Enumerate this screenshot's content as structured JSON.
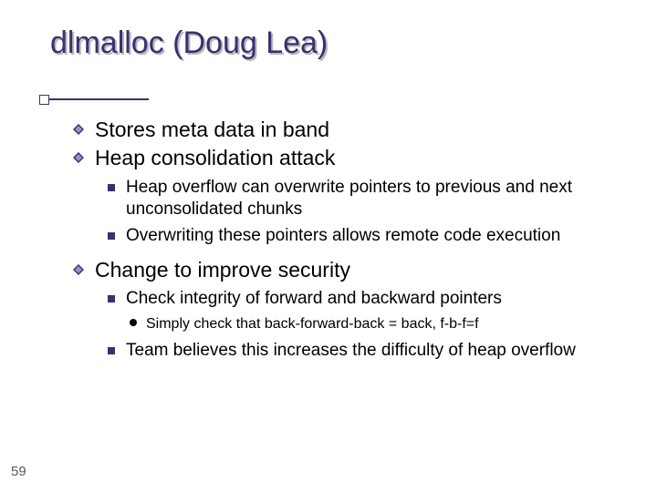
{
  "title": "dlmalloc (Doug Lea)",
  "points": {
    "p1": "Stores meta data in band",
    "p2": "Heap consolidation attack",
    "p2a": "Heap overflow can overwrite pointers to previous and next unconsolidated chunks",
    "p2b": "Overwriting these pointers allows remote code execution",
    "p3": "Change to improve security",
    "p3a": "Check integrity of forward and backward pointers",
    "p3a1": "Simply check that back-forward-back = back,  f-b-f=f",
    "p3b": "Team believes this increases the difficulty of heap overflow"
  },
  "page_number": "59"
}
